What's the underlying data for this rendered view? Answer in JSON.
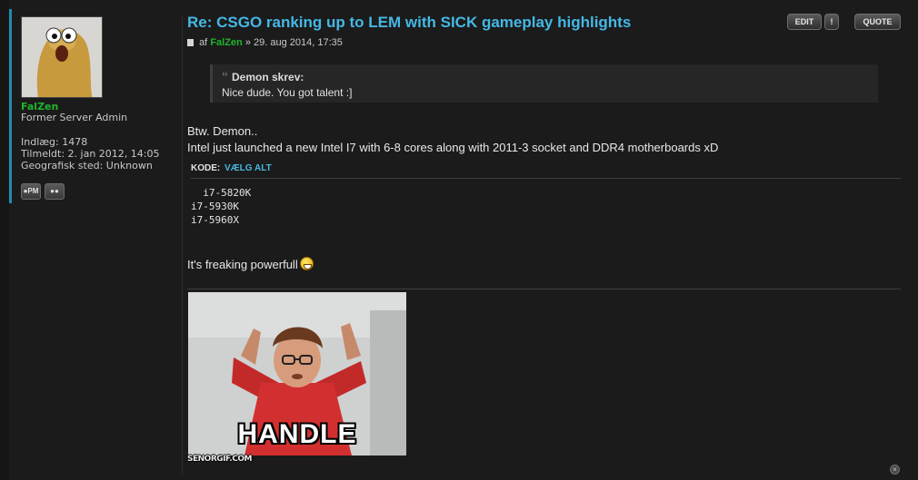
{
  "post": {
    "title": "Re: CSGO ranking up to LEM with SICK gameplay highlights",
    "meta_prefix": "af",
    "author": "FalZen",
    "meta_suffix": "» 29. aug 2014, 17:35",
    "buttons": {
      "edit": "EDIT",
      "report": "!",
      "quote": "QUOTE"
    },
    "quote": {
      "author": "Demon skrev:",
      "text": "Nice dude. You got talent :]"
    },
    "line1": "Btw. Demon..",
    "line2": "Intel just launched a new Intel I7 with 6-8 cores along with 2011-3 socket and DDR4 motherboards xD",
    "code": {
      "label": "KODE:",
      "select_all": "VÆLG ALT",
      "lines": "  i7-5820K\ni7-5930K\ni7-5960X"
    },
    "line3": "It's freaking powerfull",
    "gif": {
      "caption": "HANDLE",
      "watermark": "SENORGIF.COM"
    }
  },
  "profile": {
    "username": "FalZen",
    "rank": "Former Server Admin",
    "posts": "Indlæg: 1478",
    "joined": "Tilmeldt: 2. jan 2012, 14:05",
    "location": "Geografisk sted: Unknown",
    "pm_label": "PM"
  },
  "colors": {
    "accent": "#45b8e5",
    "username": "#1fb52c",
    "background": "#1b1b1b"
  }
}
